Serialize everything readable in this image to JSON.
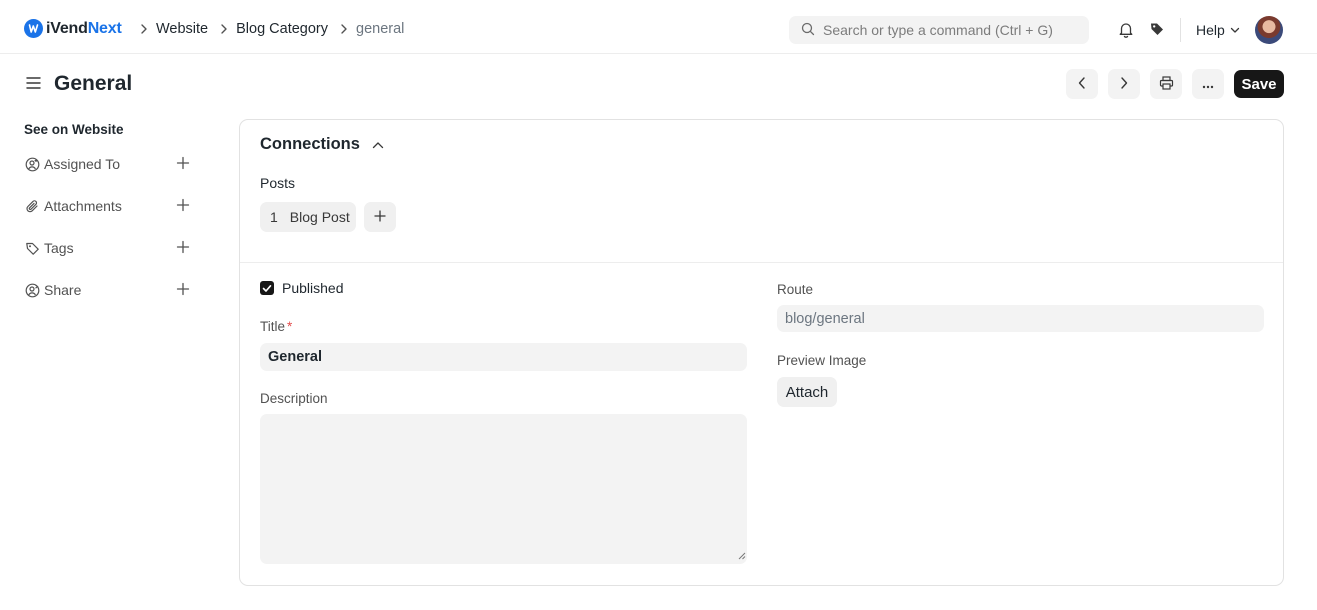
{
  "navbar": {
    "logo_prefix": "iVend",
    "logo_accent": "Next",
    "logo_mark": "iV",
    "breadcrumbs": [
      "Website",
      "Blog Category",
      "general"
    ],
    "search_placeholder": "Search or type a command (Ctrl + G)",
    "help_label": "Help",
    "icons": [
      "search-icon",
      "bell-icon",
      "tag-icon",
      "chevron-down-icon",
      "avatar"
    ]
  },
  "page": {
    "title": "General",
    "save_label": "Save"
  },
  "sidebar": {
    "title": "See on Website",
    "items": [
      {
        "label": "Assigned To",
        "icon": "assign-user-icon"
      },
      {
        "label": "Attachments",
        "icon": "paperclip-icon"
      },
      {
        "label": "Tags",
        "icon": "tag-icon"
      },
      {
        "label": "Share",
        "icon": "share-user-icon"
      }
    ]
  },
  "connections": {
    "title": "Connections",
    "group_label": "Posts",
    "doc": {
      "count": "1",
      "label": "Blog Post"
    }
  },
  "form": {
    "published_label": "Published",
    "published": true,
    "title_label": "Title",
    "title_required_mark": "*",
    "title_value": "General",
    "description_label": "Description",
    "description_value": "",
    "route_label": "Route",
    "route_value": "blog/general",
    "preview_image_label": "Preview Image",
    "attach_label": "Attach"
  },
  "colors": {
    "accent": "#1a73e8",
    "primary_button": "#171717",
    "field_bg": "#f3f3f3",
    "required": "#e24c4c"
  }
}
